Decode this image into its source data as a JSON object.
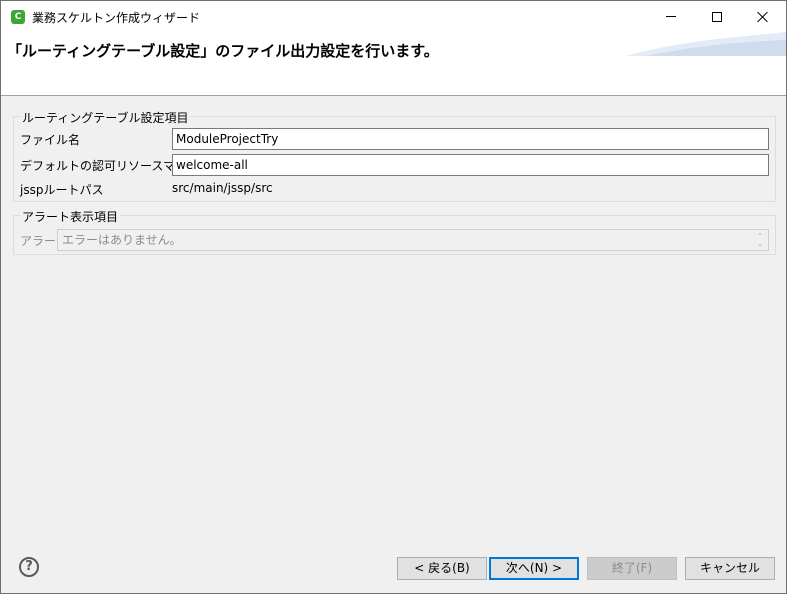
{
  "window": {
    "title": "業務スケルトン作成ウィザード",
    "app_icon": "C"
  },
  "banner": {
    "title": "「ルーティングテーブル設定」のファイル出力設定を行います。"
  },
  "settings_group": {
    "legend": "ルーティングテーブル設定項目",
    "file_name_label": "ファイル名",
    "file_name_value": "ModuleProjectTry",
    "default_mapper_label": "デフォルトの認可リソースマッパー",
    "default_mapper_value": "welcome-all",
    "jssp_root_label": "jsspルートパス",
    "jssp_root_value": "src/main/jssp/src"
  },
  "alert_group": {
    "legend": "アラート表示項目",
    "alert_label": "アラート",
    "alert_value": "エラーはありません。"
  },
  "footer": {
    "help_icon": "?",
    "back_label": "< 戻る(B)",
    "next_label": "次へ(N) >",
    "finish_label": "終了(F)",
    "cancel_label": "キャンセル"
  }
}
